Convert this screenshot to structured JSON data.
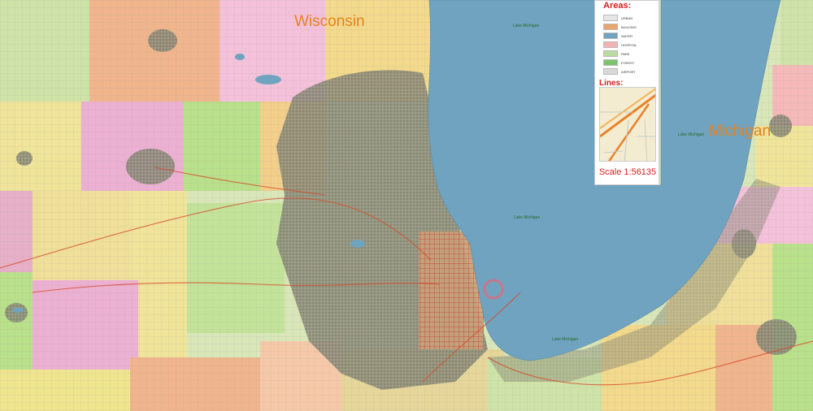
{
  "map": {
    "regions": {
      "wisconsin": "Wisconsin",
      "michigan": "Michigan"
    },
    "water_labels": {
      "lake_top": "Lake Michigan",
      "lake_mid": "Lake Michigan",
      "lake_bottom": "Lake Michigan",
      "lake_east": "Lake Michigan"
    },
    "colors": {
      "lake": "#6fa3c0",
      "region_label": "#e8821e",
      "legend_title": "#d81e1e"
    }
  },
  "legend": {
    "areas_title": "Areas:",
    "areas": [
      {
        "label": "URBAN",
        "color": "#e6e6e6"
      },
      {
        "label": "BUILDING",
        "color": "#e9a56e"
      },
      {
        "label": "WATER",
        "color": "#6fa3c0"
      },
      {
        "label": "HOSPITAL",
        "color": "#f3b3b3"
      },
      {
        "label": "PARK",
        "color": "#b9dca0"
      },
      {
        "label": "FOREST",
        "color": "#7cc36a"
      },
      {
        "label": "AIRPORT",
        "color": "#d9d9d9"
      }
    ],
    "lines_title": "Lines:",
    "scale": "Scale  1:56135"
  }
}
